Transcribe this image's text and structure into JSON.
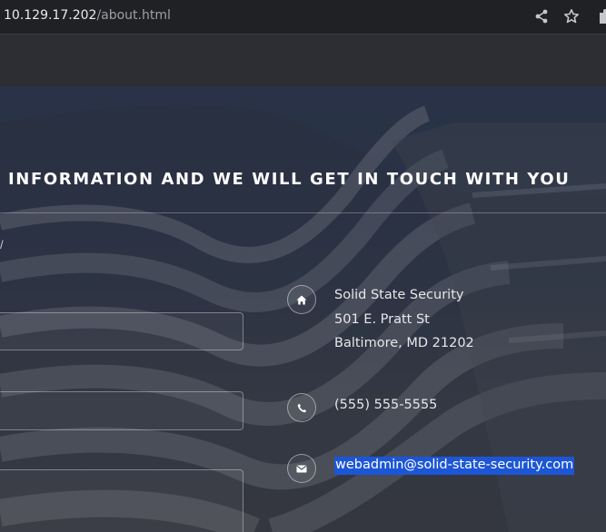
{
  "browser": {
    "url_host": "10.129.17.202",
    "url_path": "/about.html",
    "icons": [
      "share-icon",
      "star-icon",
      "extension-icon"
    ]
  },
  "contact": {
    "headline": "INFORMATION AND WE WILL GET IN TOUCH WITH YOU",
    "fragment": "/",
    "address": {
      "company": "Solid State Security",
      "street": "501 E. Pratt St",
      "city": "Baltimore, MD 21202",
      "icon": "home-icon"
    },
    "phone": {
      "value": "(555) 555-5555",
      "icon": "phone-icon"
    },
    "email": {
      "value": "webadmin@solid-state-security.com",
      "icon": "envelope-icon",
      "selected": true
    },
    "form": {
      "name_value": "",
      "email_value": "",
      "message_value": ""
    }
  },
  "colors": {
    "selection": "#1c56d6",
    "chrome": "#202124",
    "text": "#e6e7ea"
  }
}
